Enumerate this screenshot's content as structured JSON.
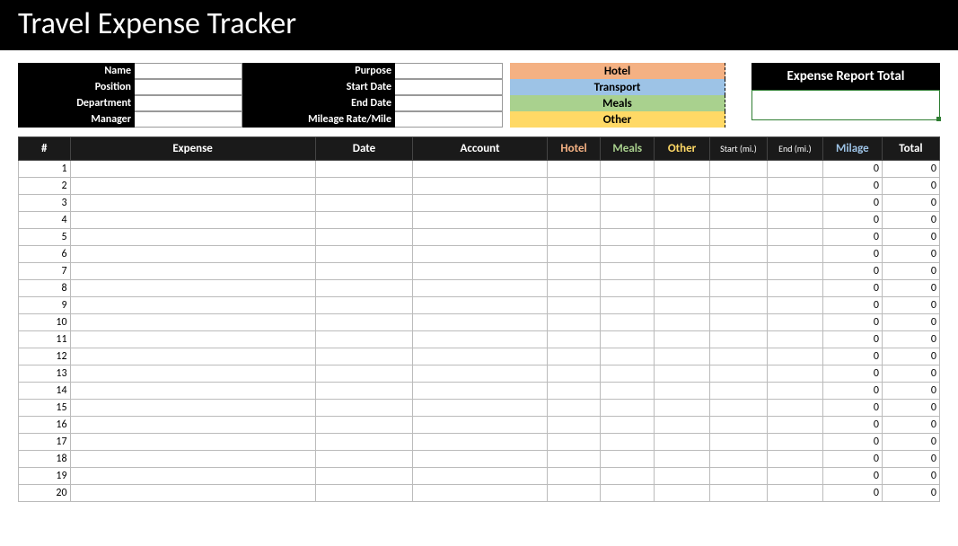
{
  "title": "Travel Expense Tracker",
  "info": {
    "labels": {
      "name": "Name",
      "position": "Position",
      "department": "Department",
      "manager": "Manager",
      "purpose": "Purpose",
      "start_date": "Start Date",
      "end_date": "End Date",
      "mileage_rate": "Mileage Rate/Mile"
    },
    "values": {
      "name": "",
      "position": "",
      "department": "",
      "manager": "",
      "purpose": "",
      "start_date": "",
      "end_date": "",
      "mileage_rate": ""
    }
  },
  "categories": {
    "hotel": "Hotel",
    "transport": "Transport",
    "meals": "Meals",
    "other": "Other"
  },
  "report_total": {
    "label": "Expense Report Total",
    "value": ""
  },
  "columns": {
    "num": "#",
    "expense": "Expense",
    "date": "Date",
    "account": "Account",
    "hotel": "Hotel",
    "meals": "Meals",
    "other": "Other",
    "start": "Start (mi.)",
    "end": "End (mi.)",
    "milage": "Milage",
    "total": "Total"
  },
  "rows": [
    {
      "n": "1",
      "expense": "",
      "date": "",
      "account": "",
      "hotel": "",
      "meals": "",
      "other": "",
      "start": "",
      "end": "",
      "milage": "0",
      "total": "0"
    },
    {
      "n": "2",
      "expense": "",
      "date": "",
      "account": "",
      "hotel": "",
      "meals": "",
      "other": "",
      "start": "",
      "end": "",
      "milage": "0",
      "total": "0"
    },
    {
      "n": "3",
      "expense": "",
      "date": "",
      "account": "",
      "hotel": "",
      "meals": "",
      "other": "",
      "start": "",
      "end": "",
      "milage": "0",
      "total": "0"
    },
    {
      "n": "4",
      "expense": "",
      "date": "",
      "account": "",
      "hotel": "",
      "meals": "",
      "other": "",
      "start": "",
      "end": "",
      "milage": "0",
      "total": "0"
    },
    {
      "n": "5",
      "expense": "",
      "date": "",
      "account": "",
      "hotel": "",
      "meals": "",
      "other": "",
      "start": "",
      "end": "",
      "milage": "0",
      "total": "0"
    },
    {
      "n": "6",
      "expense": "",
      "date": "",
      "account": "",
      "hotel": "",
      "meals": "",
      "other": "",
      "start": "",
      "end": "",
      "milage": "0",
      "total": "0"
    },
    {
      "n": "7",
      "expense": "",
      "date": "",
      "account": "",
      "hotel": "",
      "meals": "",
      "other": "",
      "start": "",
      "end": "",
      "milage": "0",
      "total": "0"
    },
    {
      "n": "8",
      "expense": "",
      "date": "",
      "account": "",
      "hotel": "",
      "meals": "",
      "other": "",
      "start": "",
      "end": "",
      "milage": "0",
      "total": "0"
    },
    {
      "n": "9",
      "expense": "",
      "date": "",
      "account": "",
      "hotel": "",
      "meals": "",
      "other": "",
      "start": "",
      "end": "",
      "milage": "0",
      "total": "0"
    },
    {
      "n": "10",
      "expense": "",
      "date": "",
      "account": "",
      "hotel": "",
      "meals": "",
      "other": "",
      "start": "",
      "end": "",
      "milage": "0",
      "total": "0"
    },
    {
      "n": "11",
      "expense": "",
      "date": "",
      "account": "",
      "hotel": "",
      "meals": "",
      "other": "",
      "start": "",
      "end": "",
      "milage": "0",
      "total": "0"
    },
    {
      "n": "12",
      "expense": "",
      "date": "",
      "account": "",
      "hotel": "",
      "meals": "",
      "other": "",
      "start": "",
      "end": "",
      "milage": "0",
      "total": "0"
    },
    {
      "n": "13",
      "expense": "",
      "date": "",
      "account": "",
      "hotel": "",
      "meals": "",
      "other": "",
      "start": "",
      "end": "",
      "milage": "0",
      "total": "0"
    },
    {
      "n": "14",
      "expense": "",
      "date": "",
      "account": "",
      "hotel": "",
      "meals": "",
      "other": "",
      "start": "",
      "end": "",
      "milage": "0",
      "total": "0"
    },
    {
      "n": "15",
      "expense": "",
      "date": "",
      "account": "",
      "hotel": "",
      "meals": "",
      "other": "",
      "start": "",
      "end": "",
      "milage": "0",
      "total": "0"
    },
    {
      "n": "16",
      "expense": "",
      "date": "",
      "account": "",
      "hotel": "",
      "meals": "",
      "other": "",
      "start": "",
      "end": "",
      "milage": "0",
      "total": "0"
    },
    {
      "n": "17",
      "expense": "",
      "date": "",
      "account": "",
      "hotel": "",
      "meals": "",
      "other": "",
      "start": "",
      "end": "",
      "milage": "0",
      "total": "0"
    },
    {
      "n": "18",
      "expense": "",
      "date": "",
      "account": "",
      "hotel": "",
      "meals": "",
      "other": "",
      "start": "",
      "end": "",
      "milage": "0",
      "total": "0"
    },
    {
      "n": "19",
      "expense": "",
      "date": "",
      "account": "",
      "hotel": "",
      "meals": "",
      "other": "",
      "start": "",
      "end": "",
      "milage": "0",
      "total": "0"
    },
    {
      "n": "20",
      "expense": "",
      "date": "",
      "account": "",
      "hotel": "",
      "meals": "",
      "other": "",
      "start": "",
      "end": "",
      "milage": "0",
      "total": "0"
    }
  ]
}
